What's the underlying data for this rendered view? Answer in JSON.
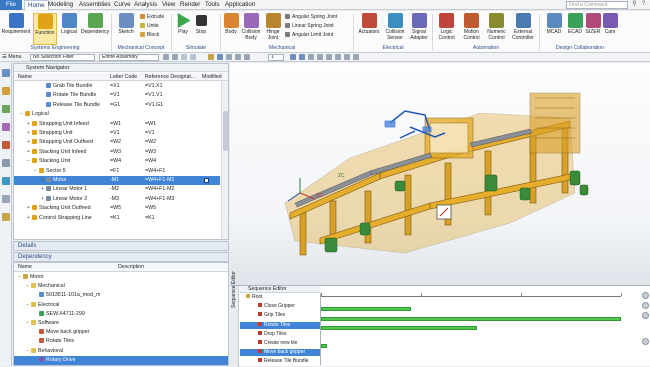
{
  "menubar": {
    "items": [
      "File",
      "Home",
      "Modeling",
      "Assemblies",
      "Curve",
      "Analysis",
      "View",
      "Render",
      "Tools",
      "Application"
    ],
    "search_placeholder": "Find a Command"
  },
  "ribbon": {
    "buttons": [
      {
        "label": "Requirement",
        "icon": "requirement-icon",
        "color": "#3b73c6"
      },
      {
        "label": "Function",
        "icon": "function-icon",
        "color": "#e0a219"
      },
      {
        "label": "Logical",
        "icon": "logical-icon",
        "color": "#4f86c6"
      },
      {
        "label": "Dependency",
        "icon": "dependency-icon",
        "color": "#5aa552"
      },
      {
        "label": "Sketch",
        "icon": "sketch-icon",
        "color": "#6b8fc0"
      },
      {
        "label": "Play",
        "icon": "play-icon",
        "color": "#3aa54a"
      },
      {
        "label": "Stop",
        "icon": "stop-icon",
        "color": "#333333"
      },
      {
        "label": "Body",
        "icon": "body-icon",
        "color": "#d9862e"
      },
      {
        "label": "Collision Body",
        "icon": "collision-body-icon",
        "color": "#9a6ab8"
      },
      {
        "label": "Hinge Joint",
        "icon": "hinge-joint-icon",
        "color": "#b8862e"
      },
      {
        "label": "Actuators",
        "icon": "actuators-icon",
        "color": "#c04a3a"
      },
      {
        "label": "Collision Sensor",
        "icon": "collision-sensor-icon",
        "color": "#3a8fc0"
      },
      {
        "label": "Signal Adapter",
        "icon": "signal-adapter-icon",
        "color": "#6a6ab8"
      },
      {
        "label": "Logic Control",
        "icon": "logic-control-icon",
        "color": "#c0443a"
      },
      {
        "label": "Motion Control",
        "icon": "motion-control-icon",
        "color": "#c05a2e"
      },
      {
        "label": "Numeric Control",
        "icon": "numeric-control-icon",
        "color": "#8a8a2e"
      },
      {
        "label": "External Controller",
        "icon": "external-controller-icon",
        "color": "#4a7ab0"
      },
      {
        "label": "MCAD",
        "icon": "mcad-icon",
        "color": "#5a8ac0"
      },
      {
        "label": "ECAD",
        "icon": "ecad-icon",
        "color": "#3aa05a"
      },
      {
        "label": "SIZER",
        "icon": "sizer-icon",
        "color": "#b04a7a"
      },
      {
        "label": "Cam",
        "icon": "cam-icon",
        "color": "#7a5ab0"
      }
    ],
    "small_items": [
      "Extrude",
      "Unite",
      "Block",
      "Angular Spring Joint",
      "Linear Spring Joint",
      "Angular Limit Joint"
    ],
    "groups": [
      "Systems Engineering",
      "Mechanical Concept",
      "Simulate",
      "Mechanical",
      "Electrical",
      "Automation",
      "Design Collaboration"
    ]
  },
  "toolbar": {
    "menu_label": "Menu",
    "filter_value": "No Selection Filter",
    "scope_value": "Entire Assembly",
    "step_value": "1"
  },
  "navigator": {
    "title": "System Navigator",
    "columns": [
      "Name",
      "Letter Code",
      "Reference Designat...",
      "Modified"
    ],
    "rows": [
      {
        "name": "Grab Tile Bundle",
        "code": "=X1",
        "ref": "=V1.X1",
        "toggle": "",
        "sel": false
      },
      {
        "name": "Rotate Tile Bundle",
        "code": "=V1",
        "ref": "=V1.V1",
        "toggle": "",
        "sel": false
      },
      {
        "name": "Release Tile Bundle",
        "code": "=G1",
        "ref": "=V1.G1",
        "toggle": "",
        "sel": false
      },
      {
        "name": "Logical",
        "code": "",
        "ref": "",
        "toggle": "−",
        "sel": false
      },
      {
        "name": "Strapping Unit Infeed",
        "code": "=W1",
        "ref": "=W1",
        "toggle": "+",
        "sel": false
      },
      {
        "name": "Strapping Unit",
        "code": "=V1",
        "ref": "=V1",
        "toggle": "+",
        "sel": false
      },
      {
        "name": "Strapping Unit Outfeed",
        "code": "=W2",
        "ref": "=W2",
        "toggle": "+",
        "sel": false
      },
      {
        "name": "Stacking Unit Infeed",
        "code": "=W3",
        "ref": "=W3",
        "toggle": "+",
        "sel": false
      },
      {
        "name": "Stacking Unit",
        "code": "=W4",
        "ref": "=W4",
        "toggle": "−",
        "sel": false
      },
      {
        "name": "Sector 5",
        "code": "=F1",
        "ref": "=W4+F1",
        "toggle": "−",
        "sel": false
      },
      {
        "name": "Motor",
        "code": "-M1",
        "ref": "=W4+F1-M1",
        "toggle": "+",
        "sel": true
      },
      {
        "name": "Linear Motor 1",
        "code": "-M2",
        "ref": "=W4+F1-M2",
        "toggle": "+",
        "sel": false
      },
      {
        "name": "Linear Motor 2",
        "code": "-M3",
        "ref": "=W4+F1-M3",
        "toggle": "+",
        "sel": false
      },
      {
        "name": "Stacking Unit Outfeed",
        "code": "=W5",
        "ref": "=W5",
        "toggle": "+",
        "sel": false
      },
      {
        "name": "Control Strapping Line",
        "code": "=K1",
        "ref": "=K1",
        "toggle": "+",
        "sel": false
      }
    ]
  },
  "details": {
    "title": "Details"
  },
  "dependency": {
    "title": "Dependency",
    "columns": [
      "Name",
      "Description"
    ],
    "rows": [
      {
        "name": "Motor",
        "indent": 0,
        "toggle": "−",
        "sel": false
      },
      {
        "name": "Mechanical",
        "indent": 1,
        "toggle": "−",
        "sel": false
      },
      {
        "name": "5013511-101a_mod_m",
        "indent": 2,
        "toggle": "",
        "sel": false
      },
      {
        "name": "Electrical",
        "indent": 1,
        "toggle": "−",
        "sel": false
      },
      {
        "name": "SEW.X4711-299",
        "indent": 2,
        "toggle": "",
        "sel": false
      },
      {
        "name": "Software",
        "indent": 1,
        "toggle": "−",
        "sel": false
      },
      {
        "name": "Move back gripper",
        "indent": 2,
        "toggle": "",
        "sel": false
      },
      {
        "name": "Rotate Tiles",
        "indent": 2,
        "toggle": "",
        "sel": false
      },
      {
        "name": "Behavioral",
        "indent": 1,
        "toggle": "−",
        "sel": false
      },
      {
        "name": "Rotary Drive",
        "indent": 2,
        "toggle": "",
        "sel": true
      }
    ]
  },
  "sequence_editor": {
    "title": "Sequence Editor",
    "side_label": "Sequence Editor",
    "rows": [
      {
        "name": "Root",
        "sel": false
      },
      {
        "name": "Close Gripper",
        "sel": false
      },
      {
        "name": "Grip Tiles",
        "sel": false
      },
      {
        "name": "Rotate Tiles",
        "sel": true
      },
      {
        "name": "Drop Tiles",
        "sel": false
      },
      {
        "name": "Create new tile",
        "sel": false
      },
      {
        "name": "Move back gripper",
        "sel": true
      },
      {
        "name": "Release Tile Bundle",
        "sel": false
      }
    ],
    "bars": [
      {
        "row": 2,
        "start": 0.0,
        "end": 0.3
      },
      {
        "row": 3,
        "start": 0.0,
        "end": 1.0
      },
      {
        "row": 4,
        "start": 0.0,
        "end": 0.52
      },
      {
        "row": 6,
        "start": 0.0,
        "end": 0.02
      }
    ]
  },
  "viewport": {
    "axis_labels": [
      "ZC",
      "XC"
    ]
  }
}
